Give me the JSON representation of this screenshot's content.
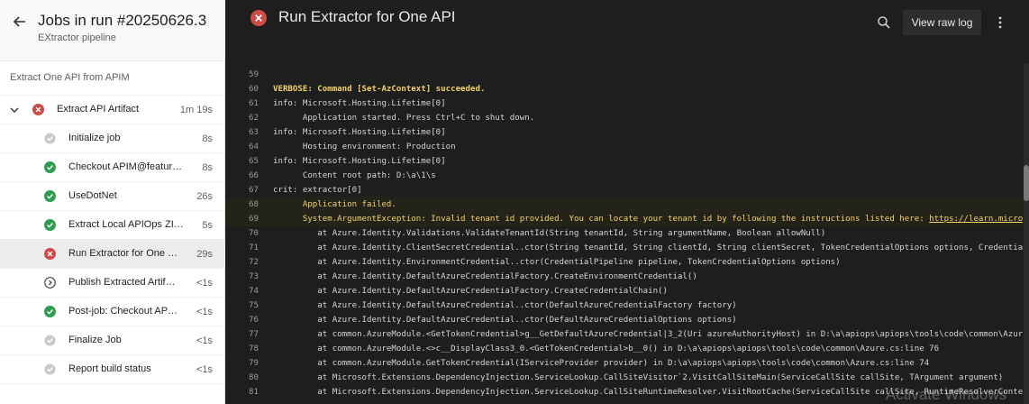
{
  "left": {
    "title": "Jobs in run #20250626.3",
    "subtitle": "EXtractor pipeline",
    "stage_label": "Extract One API from APIM",
    "job_group": {
      "label": "Extract API Artifact",
      "duration": "1m 19s",
      "status": "failed"
    },
    "steps": [
      {
        "label": "Initialize job",
        "duration": "8s",
        "status": "skipped"
      },
      {
        "label": "Checkout APIM@featur…",
        "duration": "8s",
        "status": "succeeded"
      },
      {
        "label": "UseDotNet",
        "duration": "26s",
        "status": "succeeded"
      },
      {
        "label": "Extract Local APIOps ZI…",
        "duration": "5s",
        "status": "succeeded"
      },
      {
        "label": "Run Extractor for One …",
        "duration": "29s",
        "status": "failed"
      },
      {
        "label": "Publish Extracted Artif…",
        "duration": "<1s",
        "status": "pending"
      },
      {
        "label": "Post-job: Checkout AP…",
        "duration": "<1s",
        "status": "succeeded"
      },
      {
        "label": "Finalize Job",
        "duration": "<1s",
        "status": "skipped"
      },
      {
        "label": "Report build status",
        "duration": "<1s",
        "status": "skipped"
      }
    ]
  },
  "right": {
    "title": "Run Extractor for One API",
    "view_raw_label": "View raw log",
    "watermark": "Activate Windows"
  },
  "log": [
    {
      "n": "59",
      "t": "",
      "style": ""
    },
    {
      "n": "60",
      "t": "VERBOSE: Command [Set-AzContext] succeeded.",
      "style": "verb"
    },
    {
      "n": "61",
      "t": "info: Microsoft.Hosting.Lifetime[0]",
      "style": ""
    },
    {
      "n": "62",
      "t": "      Application started. Press Ctrl+C to shut down.",
      "style": ""
    },
    {
      "n": "63",
      "t": "info: Microsoft.Hosting.Lifetime[0]",
      "style": ""
    },
    {
      "n": "64",
      "t": "      Hosting environment: Production",
      "style": ""
    },
    {
      "n": "65",
      "t": "info: Microsoft.Hosting.Lifetime[0]",
      "style": ""
    },
    {
      "n": "66",
      "t": "      Content root path: D:\\a\\1\\s",
      "style": ""
    },
    {
      "n": "67",
      "t": "crit: extractor[0]",
      "style": ""
    },
    {
      "n": "68",
      "t": "      Application failed.",
      "style": "warn"
    },
    {
      "n": "69",
      "t": "      System.ArgumentException: Invalid tenant id provided. You can locate your tenant id by following the instructions listed here: ",
      "link": "https://learn.microsoft.c",
      "style": "warn"
    },
    {
      "n": "70",
      "t": "         at Azure.Identity.Validations.ValidateTenantId(String tenantId, String argumentName, Boolean allowNull)",
      "style": ""
    },
    {
      "n": "71",
      "t": "         at Azure.Identity.ClientSecretCredential..ctor(String tenantId, String clientId, String clientSecret, TokenCredentialOptions options, CredentialPipel",
      "style": ""
    },
    {
      "n": "72",
      "t": "         at Azure.Identity.EnvironmentCredential..ctor(CredentialPipeline pipeline, TokenCredentialOptions options)",
      "style": ""
    },
    {
      "n": "73",
      "t": "         at Azure.Identity.DefaultAzureCredentialFactory.CreateEnvironmentCredential()",
      "style": ""
    },
    {
      "n": "74",
      "t": "         at Azure.Identity.DefaultAzureCredentialFactory.CreateCredentialChain()",
      "style": ""
    },
    {
      "n": "75",
      "t": "         at Azure.Identity.DefaultAzureCredential..ctor(DefaultAzureCredentialFactory factory)",
      "style": ""
    },
    {
      "n": "76",
      "t": "         at Azure.Identity.DefaultAzureCredential..ctor(DefaultAzureCredentialOptions options)",
      "style": ""
    },
    {
      "n": "77",
      "t": "         at common.AzureModule.<GetTokenCredential>g__GetDefaultAzureCredential|3_2(Uri azureAuthorityHost) in D:\\a\\apiops\\apiops\\tools\\code\\common\\Azure.cs:l",
      "style": ""
    },
    {
      "n": "78",
      "t": "         at common.AzureModule.<>c__DisplayClass3_0.<GetTokenCredential>b__0() in D:\\a\\apiops\\apiops\\tools\\code\\common\\Azure.cs:line 76",
      "style": ""
    },
    {
      "n": "79",
      "t": "         at common.AzureModule.GetTokenCredential(IServiceProvider provider) in D:\\a\\apiops\\apiops\\tools\\code\\common\\Azure.cs:line 74",
      "style": ""
    },
    {
      "n": "80",
      "t": "         at Microsoft.Extensions.DependencyInjection.ServiceLookup.CallSiteVisitor`2.VisitCallSiteMain(ServiceCallSite callSite, TArgument argument)",
      "style": ""
    },
    {
      "n": "81",
      "t": "         at Microsoft.Extensions.DependencyInjection.ServiceLookup.CallSiteRuntimeResolver.VisitRootCache(ServiceCallSite callSite, RuntimeResolverContext con",
      "style": ""
    }
  ]
}
